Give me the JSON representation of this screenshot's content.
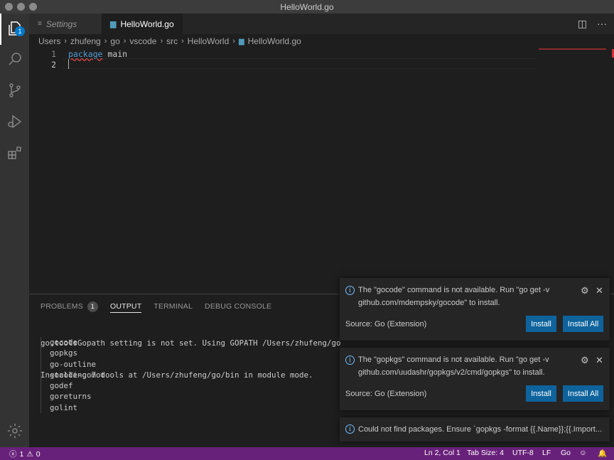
{
  "window": {
    "title": "HelloWorld.go"
  },
  "activity": {
    "explorer_badge": "1"
  },
  "tabs": [
    {
      "label": "Settings"
    },
    {
      "label": "HelloWorld.go"
    }
  ],
  "breadcrumbs": [
    "Users",
    "zhufeng",
    "go",
    "vscode",
    "src",
    "HelloWorld",
    "HelloWorld.go"
  ],
  "editor": {
    "lines": [
      {
        "num": "1",
        "keyword": "package",
        "rest": " main"
      },
      {
        "num": "2",
        "keyword": "",
        "rest": ""
      }
    ]
  },
  "panel": {
    "tabs": [
      {
        "label": "PROBLEMS",
        "badge": "1"
      },
      {
        "label": "OUTPUT"
      },
      {
        "label": "TERMINAL"
      },
      {
        "label": "DEBUG CONSOLE"
      }
    ],
    "output_lines": [
      "go.toolsGopath setting is not set. Using GOPATH /Users/zhufeng/go",
      "Installing 7 tools at /Users/zhufeng/go/bin in module mode."
    ],
    "tools": [
      "gocode",
      "gopkgs",
      "go-outline",
      "gocode-gomod",
      "godef",
      "goreturns",
      "golint"
    ]
  },
  "notifications": [
    {
      "message": "The \"gocode\" command is not available. Run \"go get -v github.com/mdempsky/gocode\" to install.",
      "source": "Source: Go (Extension)",
      "install": "Install",
      "install_all": "Install All"
    },
    {
      "message": "The \"gopkgs\" command is not available. Run \"go get -v github.com/uudashr/gopkgs/v2/cmd/gopkgs\" to install.",
      "source": "Source: Go (Extension)",
      "install": "Install",
      "install_all": "Install All"
    },
    {
      "message": "Could not find packages. Ensure `gopkgs -format {{.Name}};{{.Import..."
    }
  ],
  "status": {
    "errors": "1",
    "warnings": "0",
    "position": "Ln 2, Col 1",
    "tab_size": "Tab Size: 4",
    "encoding": "UTF-8",
    "eol": "LF",
    "language": "Go"
  },
  "colors": {
    "status_bar": "#68217a",
    "accent": "#007acc",
    "button": "#0e639c"
  }
}
